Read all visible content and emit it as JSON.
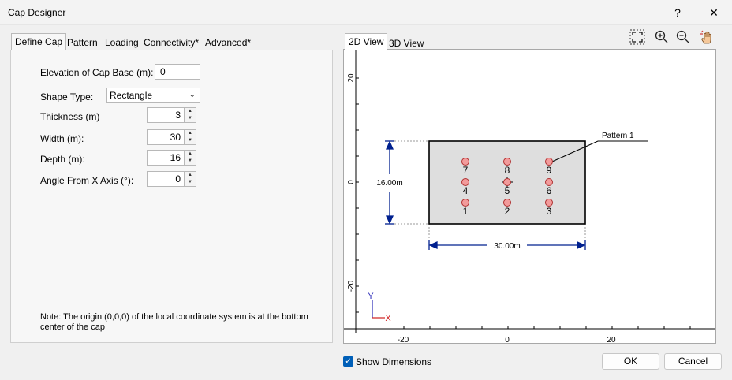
{
  "window": {
    "title": "Cap Designer",
    "help": "?",
    "close": "✕"
  },
  "tabs": [
    {
      "label": "Define Cap"
    },
    {
      "label": "Pattern"
    },
    {
      "label": "Loading"
    },
    {
      "label": "Connectivity*"
    },
    {
      "label": "Advanced*"
    }
  ],
  "form": {
    "elevation_label": "Elevation of Cap Base (m):",
    "elevation_value": "0",
    "shape_label": "Shape Type:",
    "shape_value": "Rectangle",
    "thickness_label": "Thickness (m)",
    "thickness_value": "3",
    "width_label": "Width (m):",
    "width_value": "30",
    "depth_label": "Depth (m):",
    "depth_value": "16",
    "angle_label": "Angle From X Axis (°):",
    "angle_value": "0"
  },
  "note": "Note: The origin (0,0,0) of the local coordinate system is at the bottom center of the cap",
  "view_tabs": [
    {
      "label": "2D View"
    },
    {
      "label": "3D View"
    }
  ],
  "toolbar": [
    "zoom-extents-icon",
    "zoom-in-icon",
    "zoom-out-icon",
    "pan-hand-icon"
  ],
  "plot": {
    "x_ticks": [
      "-20",
      "0",
      "20"
    ],
    "y_ticks": [
      "20",
      "0",
      "-20"
    ],
    "depth_dim": "16.00m",
    "width_dim": "30.00m",
    "pattern_label": "Pattern 1",
    "piles": [
      "1",
      "2",
      "3",
      "4",
      "5",
      "6",
      "7",
      "8",
      "9"
    ],
    "axis_x": "X",
    "axis_y": "Y",
    "colors": {
      "pile_fill": "#f29b9b",
      "cap_fill": "#dedede",
      "dim_color": "#00208f"
    }
  },
  "footer": {
    "show_dimensions_label": "Show Dimensions",
    "ok_label": "OK",
    "cancel_label": "Cancel"
  }
}
